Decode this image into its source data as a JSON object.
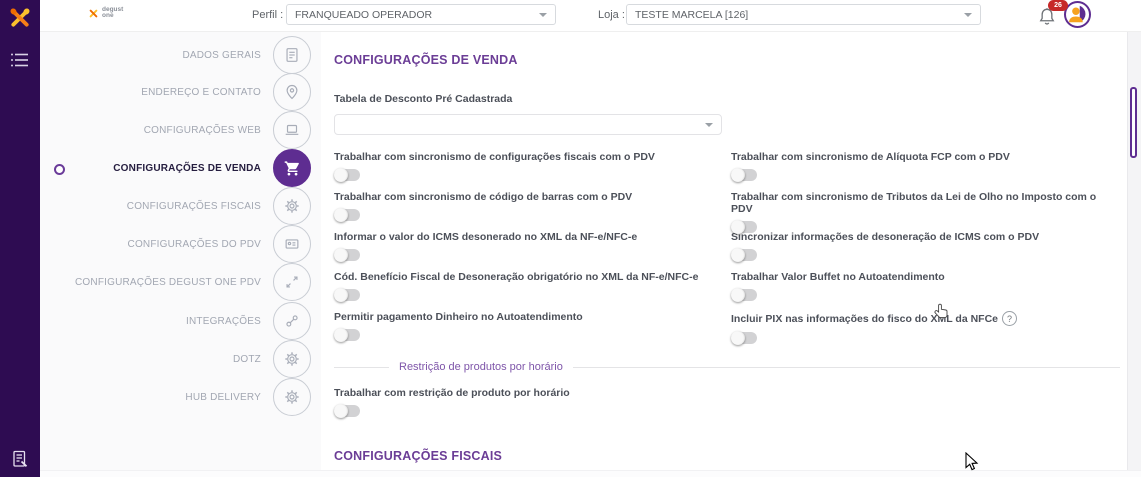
{
  "header": {
    "brand_line1": "degust",
    "brand_line2": "one",
    "perfil_label": "Perfil :",
    "perfil_value": "FRANQUEADO OPERADOR",
    "loja_label": "Loja :",
    "loja_value": "TESTE MARCELA [126]",
    "notifications_count": "26"
  },
  "sidebar": {
    "items": [
      {
        "label": "DADOS GERAIS",
        "icon": "form-icon",
        "active": false
      },
      {
        "label": "ENDEREÇO E CONTATO",
        "icon": "location-pin-icon",
        "active": false
      },
      {
        "label": "CONFIGURAÇÕES WEB",
        "icon": "laptop-icon",
        "active": false
      },
      {
        "label": "CONFIGURAÇÕES DE VENDA",
        "icon": "cart-icon",
        "active": true
      },
      {
        "label": "CONFIGURAÇÕES FISCAIS",
        "icon": "gear-icon",
        "active": false
      },
      {
        "label": "CONFIGURAÇÕES DO PDV",
        "icon": "id-card-icon",
        "active": false
      },
      {
        "label": "CONFIGURAÇÕES DEGUST ONE PDV",
        "icon": "expand-arrows-icon",
        "active": false
      },
      {
        "label": "INTEGRAÇÕES",
        "icon": "plug-icon",
        "active": false
      },
      {
        "label": "DOTZ",
        "icon": "gear-icon",
        "active": false
      },
      {
        "label": "HUB DELIVERY",
        "icon": "gear-icon",
        "active": false
      }
    ]
  },
  "main": {
    "section_title": "CONFIGURAÇÕES DE VENDA",
    "discount_field": {
      "label": "Tabela de Desconto Pré Cadastrada",
      "value": ""
    },
    "toggles": [
      {
        "label": "Trabalhar com sincronismo de configurações fiscais com o PDV",
        "state": "off"
      },
      {
        "label": "Trabalhar com sincronismo de Alíquota FCP com o PDV",
        "state": "off"
      },
      {
        "label": "Trabalhar com sincronismo de código de barras com o PDV",
        "state": "off"
      },
      {
        "label": "Trabalhar com sincronismo de Tributos da Lei de Olho no Imposto com o PDV",
        "state": "off"
      },
      {
        "label": "Informar o valor do ICMS desonerado no XML da NF-e/NFC-e",
        "state": "off"
      },
      {
        "label": "Sincronizar informações de desoneração de ICMS com o PDV",
        "state": "off"
      },
      {
        "label": "Cód. Benefício Fiscal de Desoneração obrigatório no XML da NF-e/NFC-e",
        "state": "off"
      },
      {
        "label": "Trabalhar Valor Buffet no Autoatendimento",
        "state": "off"
      },
      {
        "label": "Permitir pagamento Dinheiro no Autoatendimento",
        "state": "off"
      },
      {
        "label": "Incluir PIX nas informações do fisco do XML da NFCe",
        "state": "off",
        "help": "?"
      }
    ],
    "subsection_title": "Restrição de produtos por horário",
    "subsection_toggle": {
      "label": "Trabalhar com restrição de produto por horário",
      "state": "off"
    },
    "next_section_title": "CONFIGURAÇÕES FISCAIS"
  },
  "colors": {
    "accent": "#5e2d91",
    "rail": "#2e0c52",
    "badge": "#c62828",
    "heading": "#6b3d96"
  }
}
